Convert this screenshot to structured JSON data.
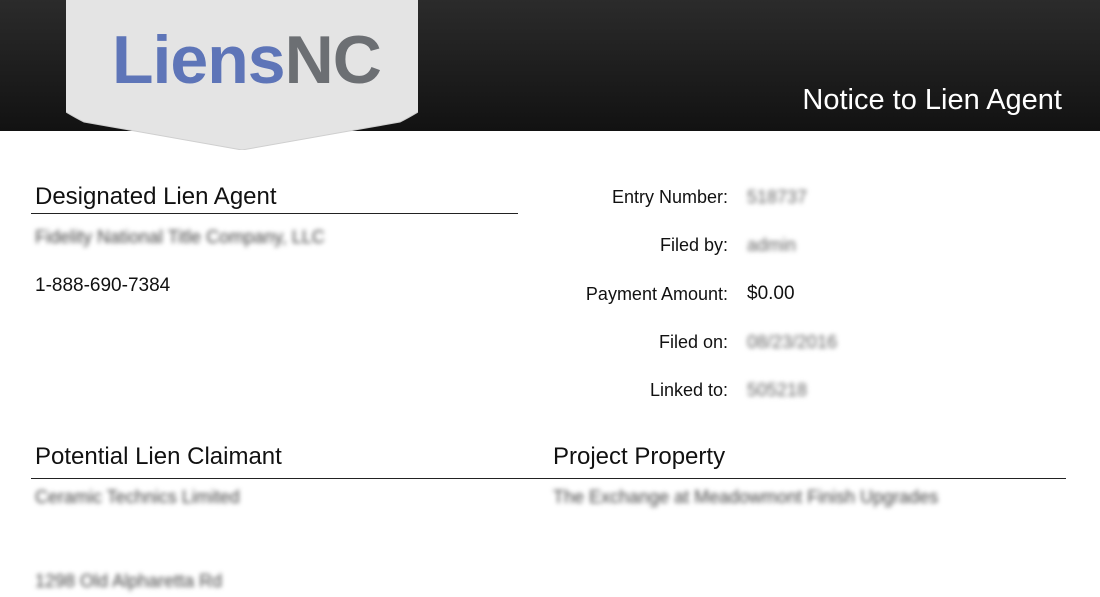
{
  "header": {
    "logo_part1": "Liens",
    "logo_part2": "NC",
    "title": "Notice to Lien Agent",
    "colors": {
      "logo_blue": "#5e75b8",
      "logo_gray": "#6c6f73",
      "bar": "#1a1a1a",
      "banner": "#e4e4e4"
    }
  },
  "lien_agent": {
    "heading": "Designated Lien Agent",
    "company": "Fidelity National Title Company, LLC",
    "phone": "1-888-690-7384"
  },
  "details": [
    {
      "label": "Entry Number:",
      "value": "518737",
      "obscured": true
    },
    {
      "label": "Filed by:",
      "value": "admin",
      "obscured": true
    },
    {
      "label": "Payment Amount:",
      "value": "$0.00",
      "obscured": false
    },
    {
      "label": "Filed on:",
      "value": "08/23/2016",
      "obscured": true
    },
    {
      "label": "Linked to:",
      "value": "505218",
      "obscured": true
    }
  ],
  "claimant": {
    "heading": "Potential Lien Claimant",
    "name": "Ceramic Technics Limited",
    "address": "1298 Old Alpharetta Rd"
  },
  "property": {
    "heading": "Project Property",
    "name": "The Exchange at Meadowmont Finish Upgrades"
  }
}
